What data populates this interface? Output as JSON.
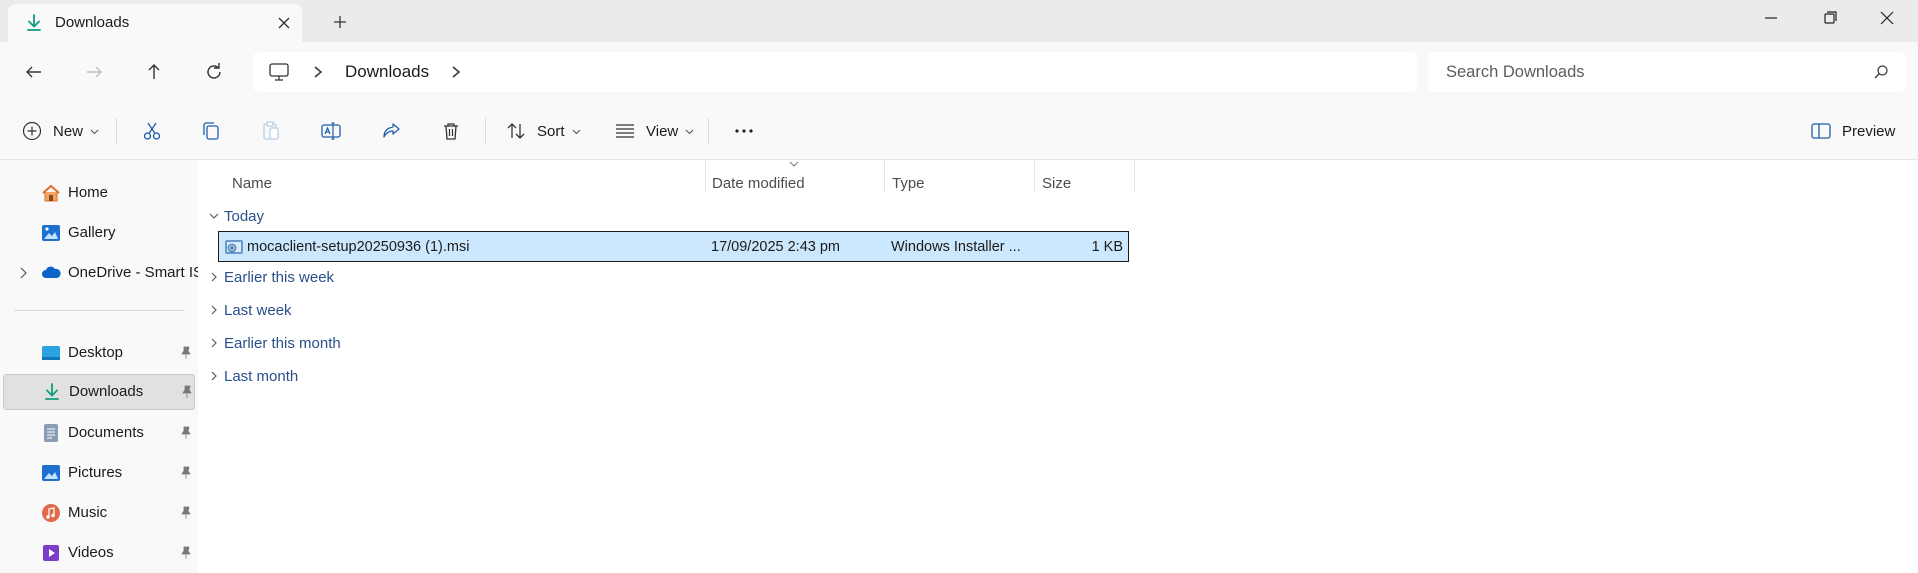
{
  "window": {
    "tab_title": "Downloads"
  },
  "address": {
    "crumbs": [
      "Downloads"
    ]
  },
  "search": {
    "placeholder": "Search Downloads"
  },
  "commands": {
    "new_label": "New",
    "sort_label": "Sort",
    "view_label": "View",
    "preview_label": "Preview"
  },
  "sidebar": {
    "items": [
      {
        "label": "Home"
      },
      {
        "label": "Gallery"
      },
      {
        "label": "OneDrive - Smart IS"
      },
      {
        "label": "Desktop"
      },
      {
        "label": "Downloads"
      },
      {
        "label": "Documents"
      },
      {
        "label": "Pictures"
      },
      {
        "label": "Music"
      },
      {
        "label": "Videos"
      }
    ]
  },
  "columns": {
    "name": "Name",
    "date": "Date modified",
    "type": "Type",
    "size": "Size"
  },
  "groups": [
    {
      "label": "Today"
    },
    {
      "label": "Earlier this week"
    },
    {
      "label": "Last week"
    },
    {
      "label": "Earlier this month"
    },
    {
      "label": "Last month"
    }
  ],
  "files": [
    {
      "name": "mocaclient-setup20250936 (1).msi",
      "date_modified": "17/09/2025 2:43 pm",
      "type": "Windows Installer ...",
      "size": "1 KB"
    }
  ],
  "colors": {
    "accent": "#0f9d7a",
    "selection": "#cce8ff",
    "group_text": "#2a4f8a"
  }
}
